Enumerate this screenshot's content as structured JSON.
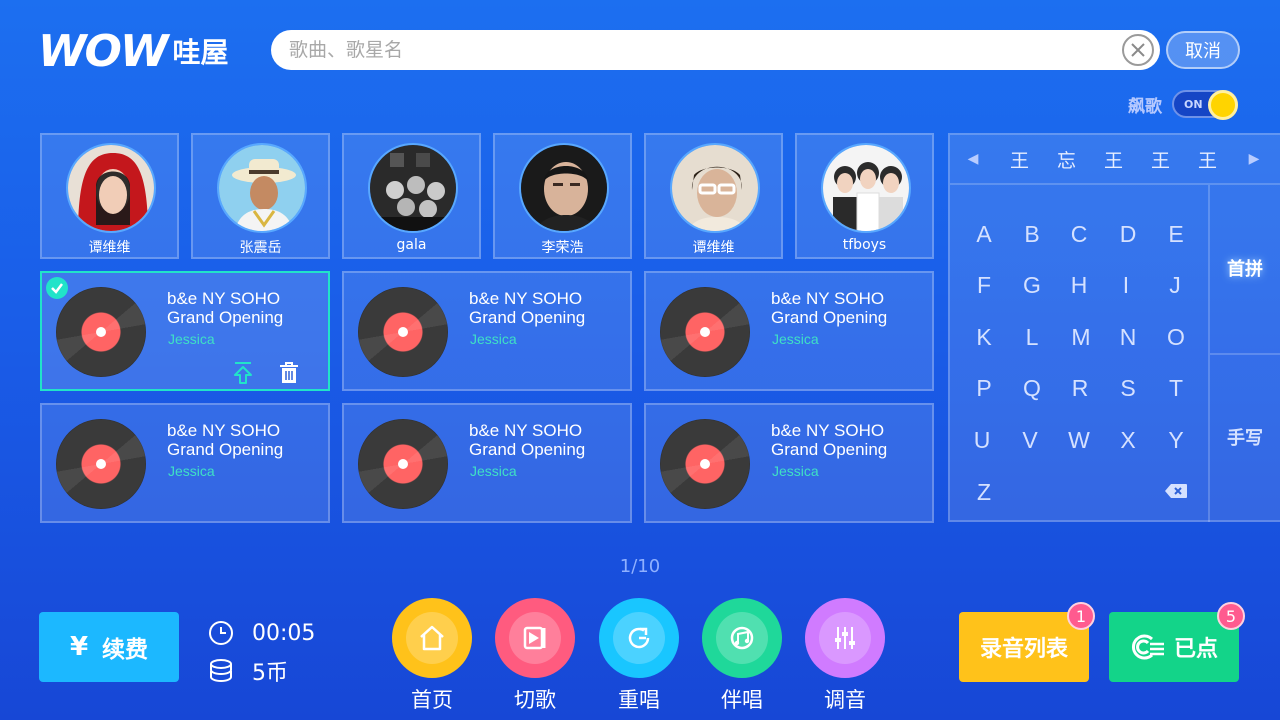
{
  "brand": {
    "logo_text": "WOW",
    "name_cn": "哇屋"
  },
  "search": {
    "placeholder": "歌曲、歌星名",
    "cancel_label": "取消"
  },
  "biaoge": {
    "label": "飙歌",
    "toggle_text": "ON",
    "on": true
  },
  "singers": [
    {
      "name": "谭维维"
    },
    {
      "name": "张震岳"
    },
    {
      "name": "gala"
    },
    {
      "name": "李荣浩"
    },
    {
      "name": "谭维维"
    },
    {
      "name": "tfboys"
    }
  ],
  "songs": [
    {
      "title": "b&e NY SOHO Grand Opening",
      "artist": "Jessica",
      "selected": true
    },
    {
      "title": "b&e NY SOHO Grand Opening",
      "artist": "Jessica"
    },
    {
      "title": "b&e NY SOHO Grand Opening",
      "artist": "Jessica"
    },
    {
      "title": "b&e NY SOHO Grand Opening",
      "artist": "Jessica"
    },
    {
      "title": "b&e NY SOHO Grand Opening",
      "artist": "Jessica"
    },
    {
      "title": "b&e NY SOHO Grand Opening",
      "artist": "Jessica"
    }
  ],
  "keyboard": {
    "candidates": [
      "王",
      "忘",
      "王",
      "王",
      "王"
    ],
    "keys": [
      "A",
      "B",
      "C",
      "D",
      "E",
      "F",
      "G",
      "H",
      "I",
      "J",
      "K",
      "L",
      "M",
      "N",
      "O",
      "P",
      "Q",
      "R",
      "S",
      "T",
      "U",
      "V",
      "W",
      "X",
      "Y",
      "Z"
    ],
    "mode_pinyin": "首拼",
    "mode_handwrite": "手写"
  },
  "pager": {
    "text": "1/10"
  },
  "bottom": {
    "renew_symbol": "¥",
    "renew_label": "续费",
    "time": "00:05",
    "coins": "5币",
    "controls": [
      {
        "label": "首页",
        "color": "#ffc21a",
        "icon": "home-icon"
      },
      {
        "label": "切歌",
        "color": "#ff5b7f",
        "icon": "skip-icon"
      },
      {
        "label": "重唱",
        "color": "#19c6ff",
        "icon": "replay-icon"
      },
      {
        "label": "伴唱",
        "color": "#1fd89a",
        "icon": "accompany-icon"
      },
      {
        "label": "调音",
        "color": "#d07bff",
        "icon": "equalizer-icon"
      }
    ],
    "record_list_label": "录音列表",
    "record_list_badge": "1",
    "ordered_label": "已点",
    "ordered_badge": "5"
  }
}
